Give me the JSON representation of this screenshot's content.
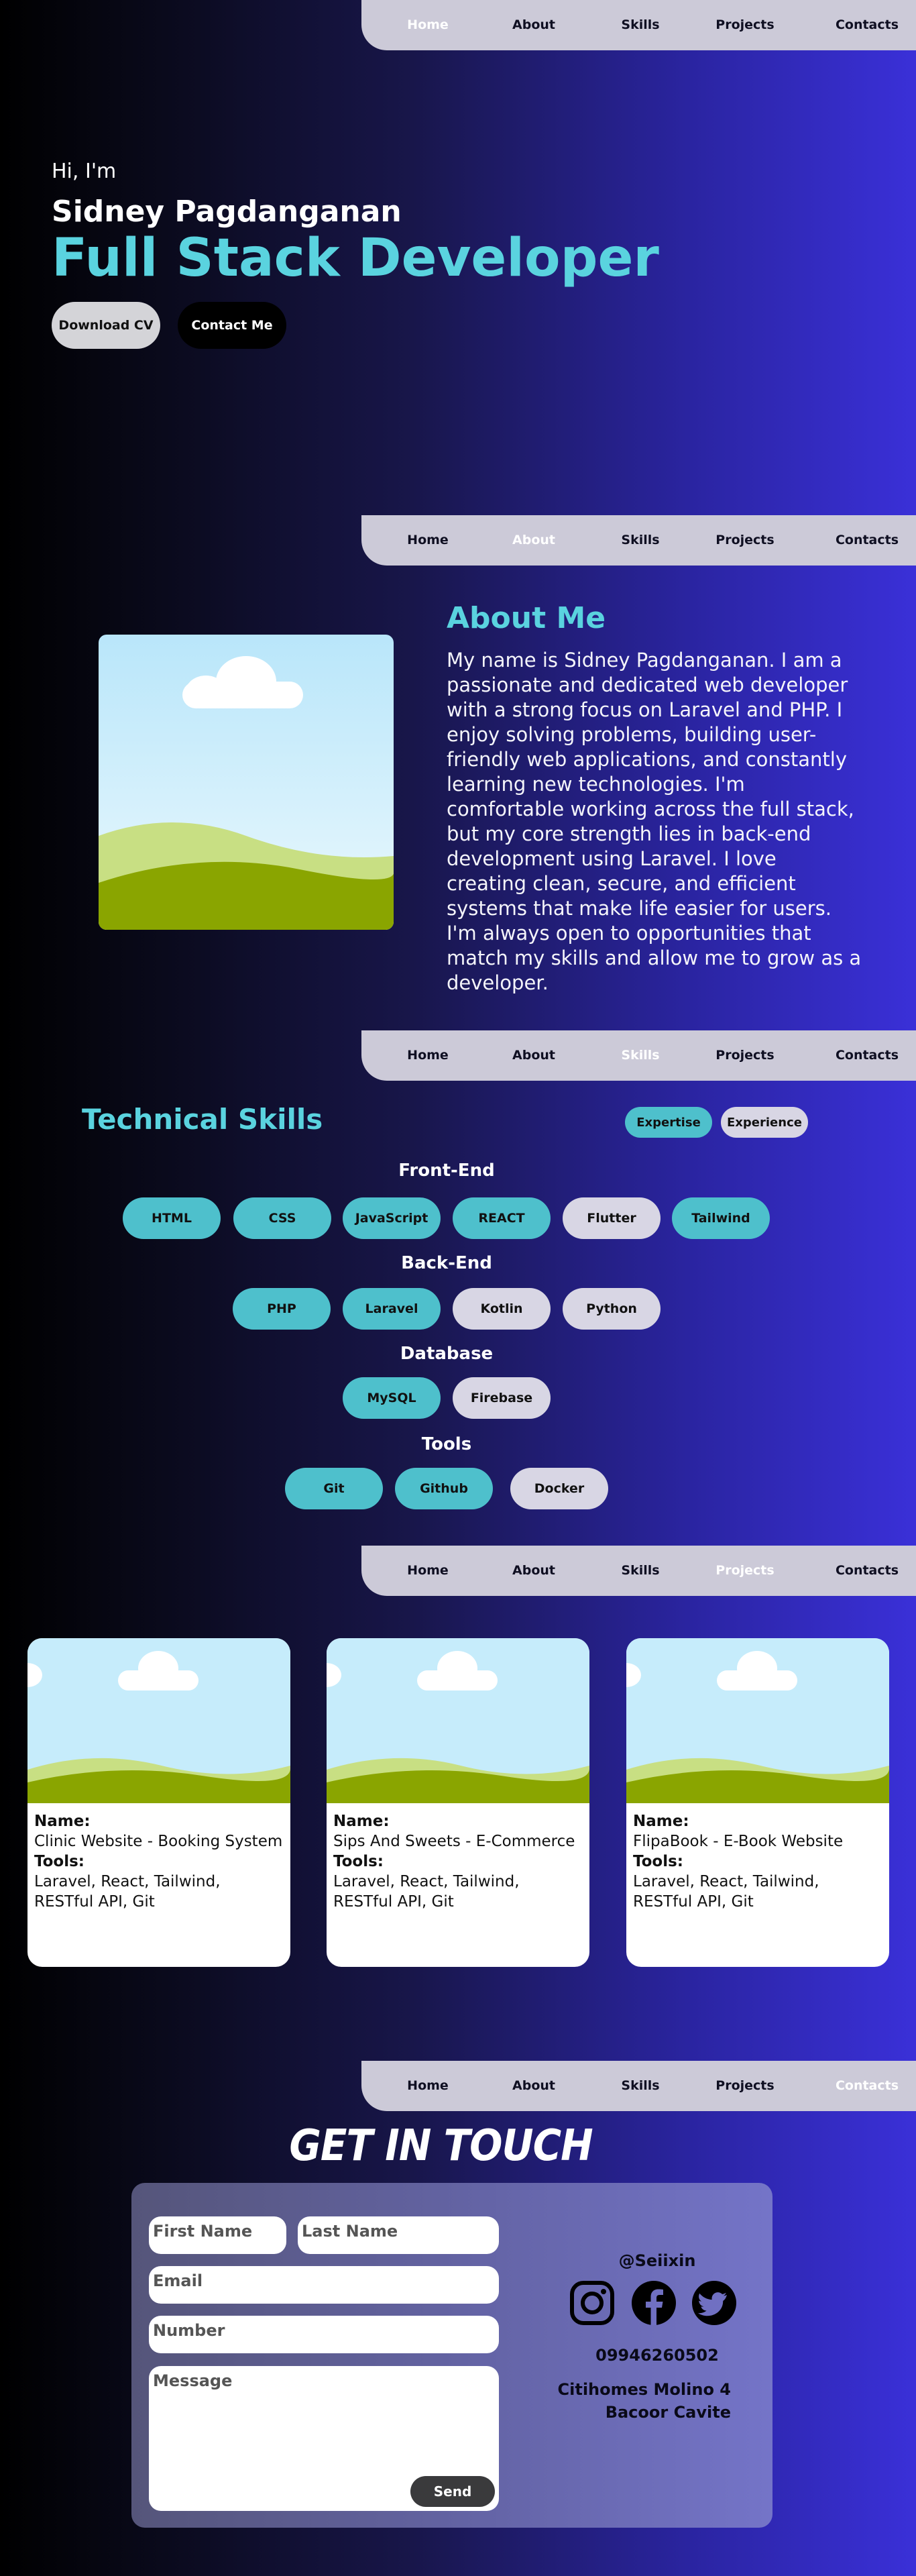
{
  "nav": {
    "items": [
      "Home",
      "About",
      "Skills",
      "Projects",
      "Contacts"
    ]
  },
  "hero": {
    "greeting": "Hi, I'm",
    "name": "Sidney Pagdanganan",
    "role": "Full Stack Developer",
    "download_label": "Download CV",
    "contact_label": "Contact Me"
  },
  "about": {
    "title": "About Me",
    "text": "My name is Sidney Pagdanganan. I am a passionate and dedicated web developer with a strong focus on Laravel and PHP. I enjoy solving problems, building user-friendly web applications, and constantly learning new technologies. I'm comfortable working across the full stack, but my core strength lies in back-end development using Laravel. I love creating clean, secure, and efficient systems that make life easier for users. I'm always open to opportunities that match my skills and allow me to grow as a developer."
  },
  "skills": {
    "title": "Technical Skills",
    "toggle": [
      "Expertise",
      "Experience"
    ],
    "groups": [
      {
        "title": "Front-End",
        "items": [
          {
            "label": "HTML",
            "style": "teal"
          },
          {
            "label": "CSS",
            "style": "teal"
          },
          {
            "label": "JavaScript",
            "style": "teal"
          },
          {
            "label": "REACT",
            "style": "teal"
          },
          {
            "label": "Flutter",
            "style": "grey"
          },
          {
            "label": "Tailwind",
            "style": "teal"
          }
        ]
      },
      {
        "title": "Back-End",
        "items": [
          {
            "label": "PHP",
            "style": "teal"
          },
          {
            "label": "Laravel",
            "style": "teal"
          },
          {
            "label": "Kotlin",
            "style": "grey"
          },
          {
            "label": "Python",
            "style": "grey"
          }
        ]
      },
      {
        "title": "Database",
        "items": [
          {
            "label": "MySQL",
            "style": "teal"
          },
          {
            "label": "Firebase",
            "style": "grey"
          }
        ]
      },
      {
        "title": "Tools",
        "items": [
          {
            "label": "Git",
            "style": "teal"
          },
          {
            "label": "Github",
            "style": "teal"
          },
          {
            "label": "Docker",
            "style": "grey"
          }
        ]
      }
    ]
  },
  "projects": {
    "name_label": "Name:",
    "tools_label": "Tools:",
    "items": [
      {
        "name": "Clinic Website - Booking System",
        "tools": "Laravel, React, Tailwind, RESTful API, Git"
      },
      {
        "name": "Sips And Sweets - E-Commerce",
        "tools": "Laravel, React, Tailwind, RESTful API, Git"
      },
      {
        "name": "FlipaBook - E-Book Website",
        "tools": "Laravel, React, Tailwind, RESTful API, Git"
      }
    ]
  },
  "contact": {
    "title": "GET IN TOUCH",
    "first_name_placeholder": "First Name",
    "last_name_placeholder": "Last Name",
    "email_placeholder": "Email",
    "number_placeholder": "Number",
    "message_placeholder": "Message",
    "send_label": "Send",
    "handle": "@Seiixin",
    "socials": [
      "instagram-icon",
      "facebook-icon",
      "twitter-icon"
    ],
    "phone": "09946260502",
    "address_line1": "Citihomes Molino 4",
    "address_line2": "Bacoor Cavite"
  },
  "colors": {
    "accent": "#5ad3df",
    "pill_teal": "#4ec0cc",
    "pill_grey": "#d8d6e4",
    "nav_bg": "#cccad8"
  }
}
